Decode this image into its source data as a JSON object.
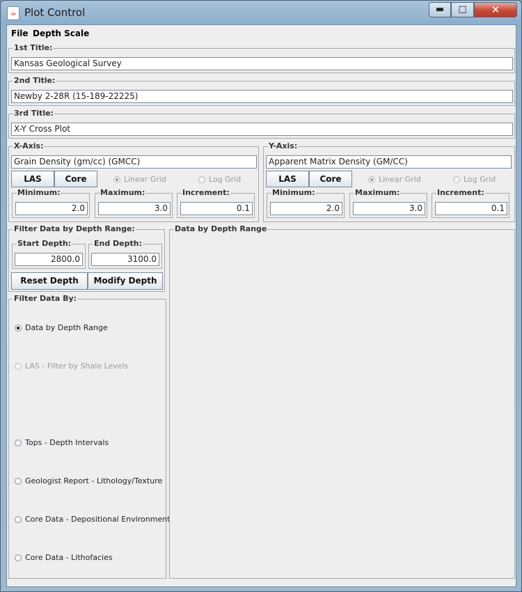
{
  "window": {
    "title": "Plot Control",
    "icon": "java-cup-icon"
  },
  "menu": [
    "File",
    "Depth Scale"
  ],
  "titles": [
    {
      "label": "1st Title:",
      "value": "Kansas Geological Survey"
    },
    {
      "label": "2nd Title:",
      "value": "Newby 2-28R (15-189-22225)"
    },
    {
      "label": "3rd Title:",
      "value": "X-Y Cross Plot"
    }
  ],
  "xaxis": {
    "label": "X-Axis:",
    "value": "Grain Density (gm/cc) (GMCC)",
    "btn_las": "LAS",
    "btn_core": "Core",
    "linear": "Linear Grid",
    "log": "Log Grid",
    "min_label": "Minimum:",
    "min": "2.0",
    "max_label": "Maximum:",
    "max": "3.0",
    "inc_label": "Increment:",
    "inc": "0.1"
  },
  "yaxis": {
    "label": "Y-Axis:",
    "value": "Apparent Matrix Density (GM/CC)",
    "btn_las": "LAS",
    "btn_core": "Core",
    "linear": "Linear Grid",
    "log": "Log Grid",
    "min_label": "Minimum:",
    "min": "2.0",
    "max_label": "Maximum:",
    "max": "3.0",
    "inc_label": "Increment:",
    "inc": "0.1"
  },
  "depth": {
    "label": "Filter Data by Depth Range:",
    "start_label": "Start Depth:",
    "start": "2800.0",
    "end_label": "End Depth:",
    "end": "3100.0",
    "reset": "Reset Depth",
    "modify": "Modify Depth"
  },
  "filter": {
    "label": "Filter Data By:",
    "options": [
      "Data by Depth Range",
      "LAS - Filter by Shale Levels",
      "Tops - Depth Intervals",
      "Geologist Report - Lithology/Texture",
      "Core Data - Depositional Environment",
      "Core Data - Lithofacies"
    ]
  },
  "panel": {
    "label": "Data by Depth Range"
  }
}
